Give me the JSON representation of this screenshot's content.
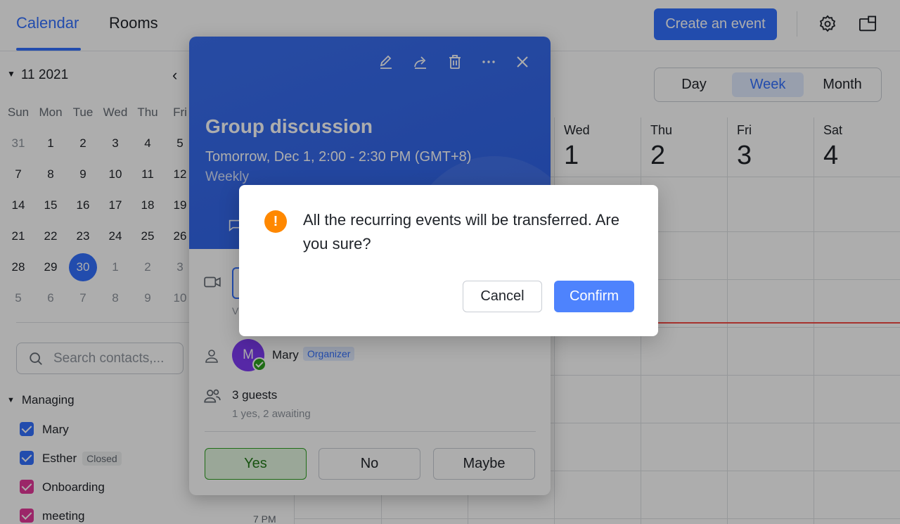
{
  "topbar": {
    "tabs": [
      {
        "label": "Calendar",
        "active": true
      },
      {
        "label": "Rooms",
        "active": false
      }
    ],
    "create_button": "Create an event",
    "icons": [
      "settings-icon",
      "window-icon"
    ]
  },
  "mini_calendar": {
    "month_label": "11 2021",
    "weekdays": [
      "Sun",
      "Mon",
      "Tue",
      "Wed",
      "Thu",
      "Fri"
    ],
    "weeks": [
      [
        "31",
        "1",
        "2",
        "3",
        "4",
        "5"
      ],
      [
        "7",
        "8",
        "9",
        "10",
        "11",
        "12"
      ],
      [
        "14",
        "15",
        "16",
        "17",
        "18",
        "19"
      ],
      [
        "21",
        "22",
        "23",
        "24",
        "25",
        "26"
      ],
      [
        "28",
        "29",
        "30",
        "1",
        "2",
        "3"
      ],
      [
        "5",
        "6",
        "7",
        "8",
        "9",
        "10"
      ]
    ],
    "selected_day": "30"
  },
  "sidebar": {
    "search_placeholder": "Search contacts,...",
    "section_label": "Managing",
    "calendars": [
      {
        "name": "Mary",
        "color": "#3370ff",
        "badge": ""
      },
      {
        "name": "Esther",
        "color": "#3370ff",
        "badge": "Closed"
      },
      {
        "name": "Onboarding",
        "color": "#e5399a",
        "badge": ""
      },
      {
        "name": "meeting",
        "color": "#e5399a",
        "badge": ""
      }
    ]
  },
  "view_switch": {
    "day": "Day",
    "week": "Week",
    "month": "Month",
    "selected": "Week"
  },
  "week_header": [
    {
      "name": "Wed",
      "num": "1"
    },
    {
      "name": "Thu",
      "num": "2"
    },
    {
      "name": "Fri",
      "num": "3"
    },
    {
      "name": "Sat",
      "num": "4"
    }
  ],
  "time_label": "7 PM",
  "event": {
    "title": "Group discussion",
    "time": "Tomorrow, Dec 1, 2:00 - 2:30 PM (GMT+8)",
    "repeat": "Weekly",
    "organizer": {
      "initial": "M",
      "name": "Mary",
      "badge": "Organizer"
    },
    "guests": "3 guests",
    "guests_status": "1 yes, 2 awaiting",
    "join_fragment": "Vi",
    "rsvp": {
      "yes": "Yes",
      "no": "No",
      "maybe": "Maybe"
    }
  },
  "dialog": {
    "message": "All the recurring events will be transferred. Are you sure?",
    "cancel": "Cancel",
    "confirm": "Confirm"
  },
  "colors": {
    "accent": "#3370ff",
    "warning": "#ff8800",
    "confirm": "#4e83fd"
  }
}
